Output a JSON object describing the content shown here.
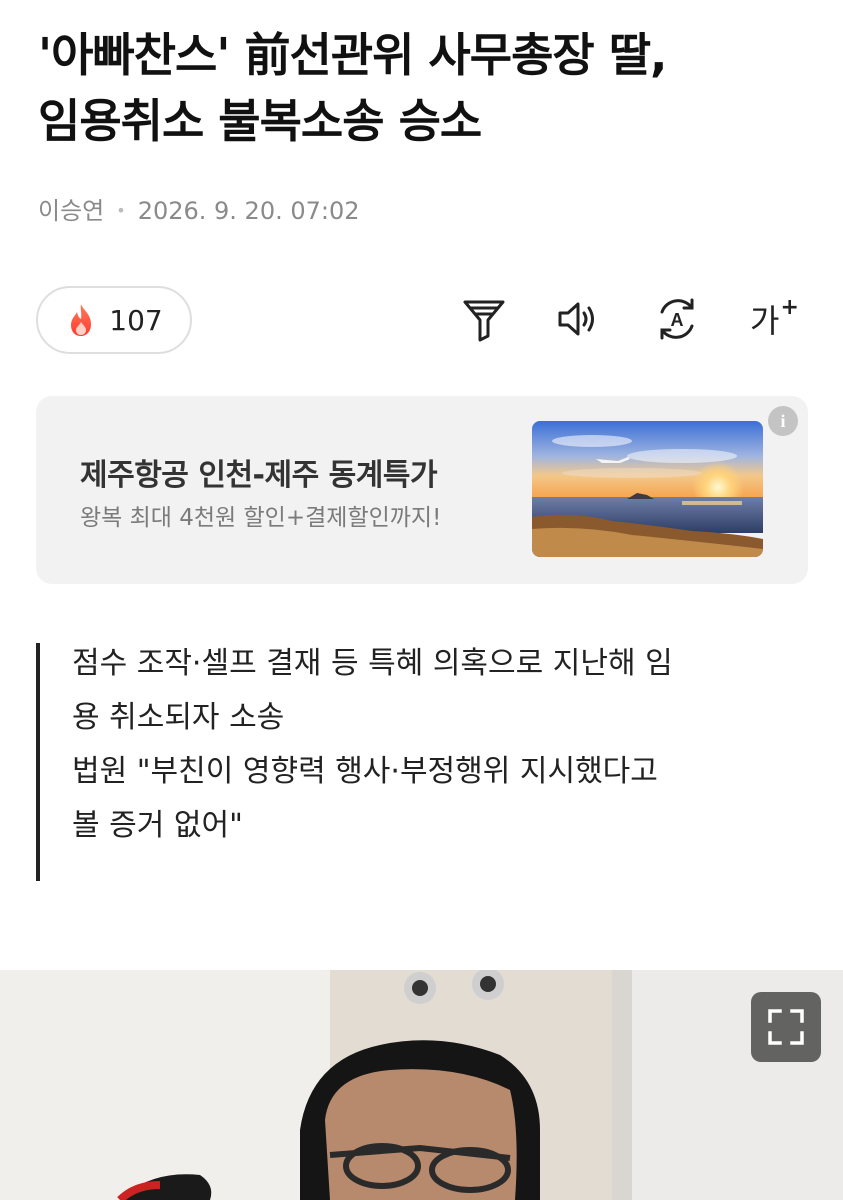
{
  "article": {
    "headline_line1": "'아빠찬스' 前선관위 사무총장 딸,",
    "headline_line2": "임용취소 불복소송 승소",
    "author": "이승연",
    "datetime": "2026. 9. 20. 07:02"
  },
  "reactions": {
    "count": "107",
    "icon": "fire-icon"
  },
  "toolbar": {
    "filter_icon": "filter-icon",
    "audio_icon": "speaker-icon",
    "translate_icon": "translate-icon",
    "font_label": "가",
    "font_plus": "+"
  },
  "ad": {
    "title": "제주항공 인천-제주 동계특가",
    "subtitle": "왕복 최대 4천원 할인+결제할인까지!",
    "info_label": "i"
  },
  "summary": {
    "line1": "점수 조작·셀프 결재 등 특혜 의혹으로 지난해 임",
    "line2": "용 취소되자 소송",
    "line3": "법원 \"부친이 영향력 행사·부정행위 지시했다고",
    "line4": "볼 증거 없어\""
  },
  "colors": {
    "text": "#111111",
    "meta": "#8a8a8a",
    "ad_bg": "#f2f2f2",
    "fire_red": "#ff4d3d"
  }
}
